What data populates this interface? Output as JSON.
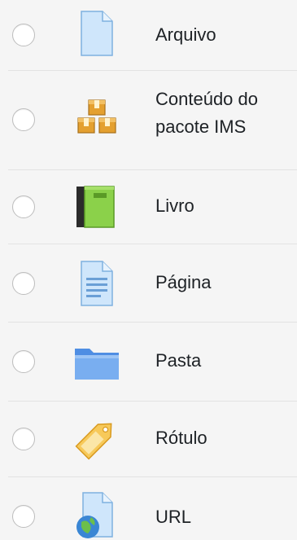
{
  "activities": [
    {
      "label": "Arquivo",
      "icon": "file-icon"
    },
    {
      "label": "Conteúdo do pacote IMS",
      "icon": "ims-package-icon"
    },
    {
      "label": "Livro",
      "icon": "book-icon"
    },
    {
      "label": "Página",
      "icon": "page-icon"
    },
    {
      "label": "Pasta",
      "icon": "folder-icon"
    },
    {
      "label": "Rótulo",
      "icon": "label-tag-icon"
    },
    {
      "label": "URL",
      "icon": "url-icon"
    }
  ],
  "colors": {
    "background": "#f5f5f5",
    "separator": "#e3e3e3",
    "text": "#1d2125",
    "radio_border": "#bdbdbd"
  }
}
